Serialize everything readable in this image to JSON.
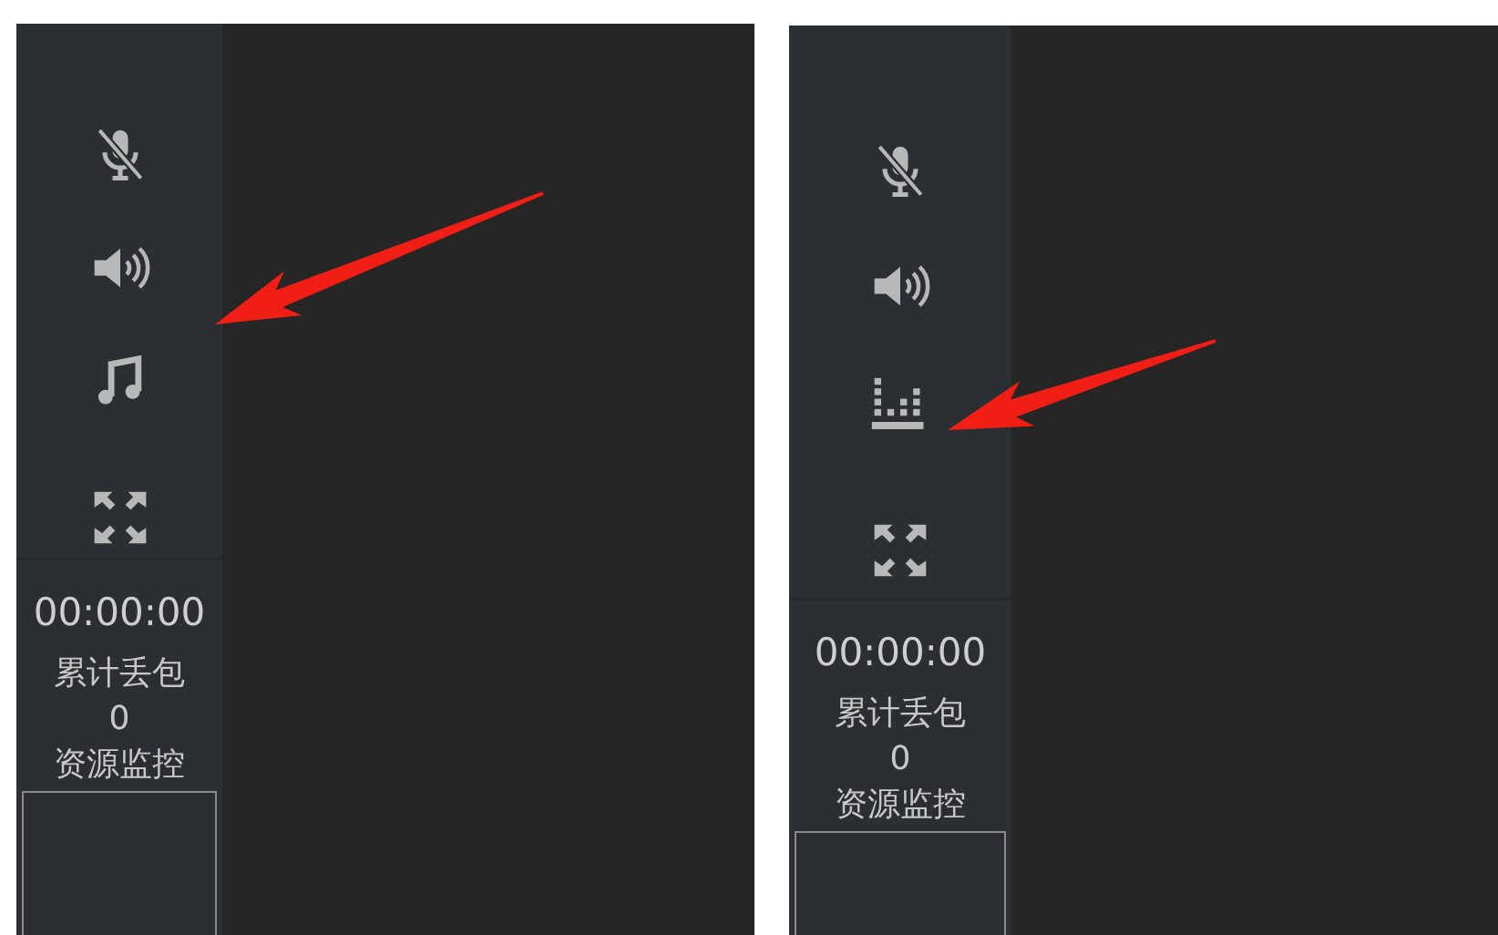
{
  "panels": [
    {
      "icons": [
        {
          "kind": "mic-muted"
        },
        {
          "kind": "speaker"
        },
        {
          "kind": "music"
        },
        {
          "kind": "expand"
        }
      ],
      "time": "00:00:00",
      "packet_loss_label": "累计丢包",
      "packet_loss_value": "0",
      "monitor_label": "资源监控",
      "annotation": {
        "kind": "arrow"
      }
    },
    {
      "icons": [
        {
          "kind": "mic-muted"
        },
        {
          "kind": "speaker"
        },
        {
          "kind": "equalizer"
        },
        {
          "kind": "expand"
        }
      ],
      "time": "00:00:00",
      "packet_loss_label": "累计丢包",
      "packet_loss_value": "0",
      "monitor_label": "资源监控",
      "annotation": {
        "kind": "arrow"
      }
    }
  ]
}
